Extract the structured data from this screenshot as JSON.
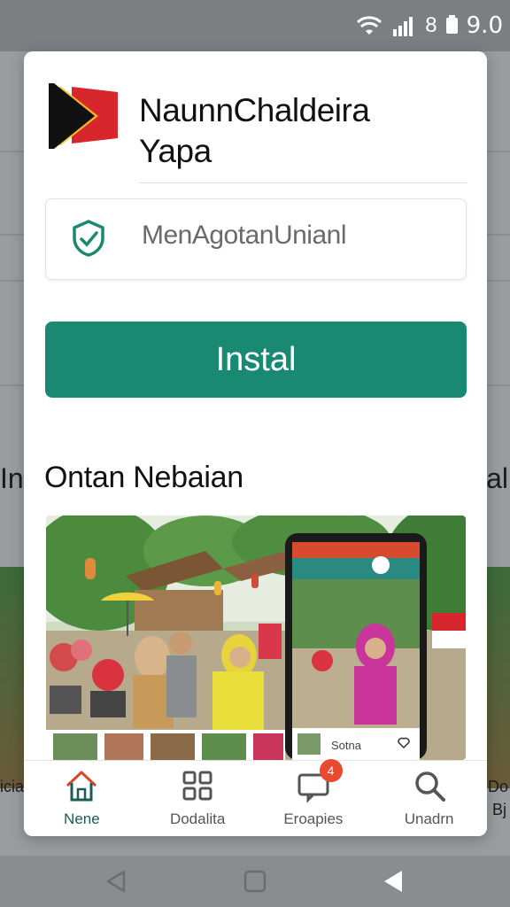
{
  "status_bar": {
    "icons": [
      "wifi-icon",
      "signal-icon",
      "battery-icon"
    ],
    "battery_text": "8",
    "time": "9.0"
  },
  "background": {
    "left_heading_fragment": "In",
    "right_heading_fragment": "al",
    "left_label_fragment": "icia",
    "right_label_fragment_1": "Do",
    "right_label_fragment_2": "Bj"
  },
  "app": {
    "title_line1": "NaunnChaldeira",
    "title_line2": "Yapa",
    "logo": "flag-logo-icon",
    "developer": "MenAgotanUnianl",
    "developer_icon": "verified-shield-icon",
    "install_label": "Instal",
    "section_title": "Ontan Nebaian"
  },
  "screenshot": {
    "phone_overlay_label": "Sotna",
    "phone_like_icon": "heart-icon"
  },
  "tabs": [
    {
      "label": "Nene",
      "icon": "home-icon",
      "active": true
    },
    {
      "label": "Dodalita",
      "icon": "grid-icon",
      "active": false
    },
    {
      "label": "Eroapies",
      "icon": "chat-icon",
      "active": false,
      "badge": "4"
    },
    {
      "label": "Unadrn",
      "icon": "search-icon",
      "active": false
    }
  ],
  "colors": {
    "accent": "#198a71",
    "badge": "#e8492f"
  }
}
